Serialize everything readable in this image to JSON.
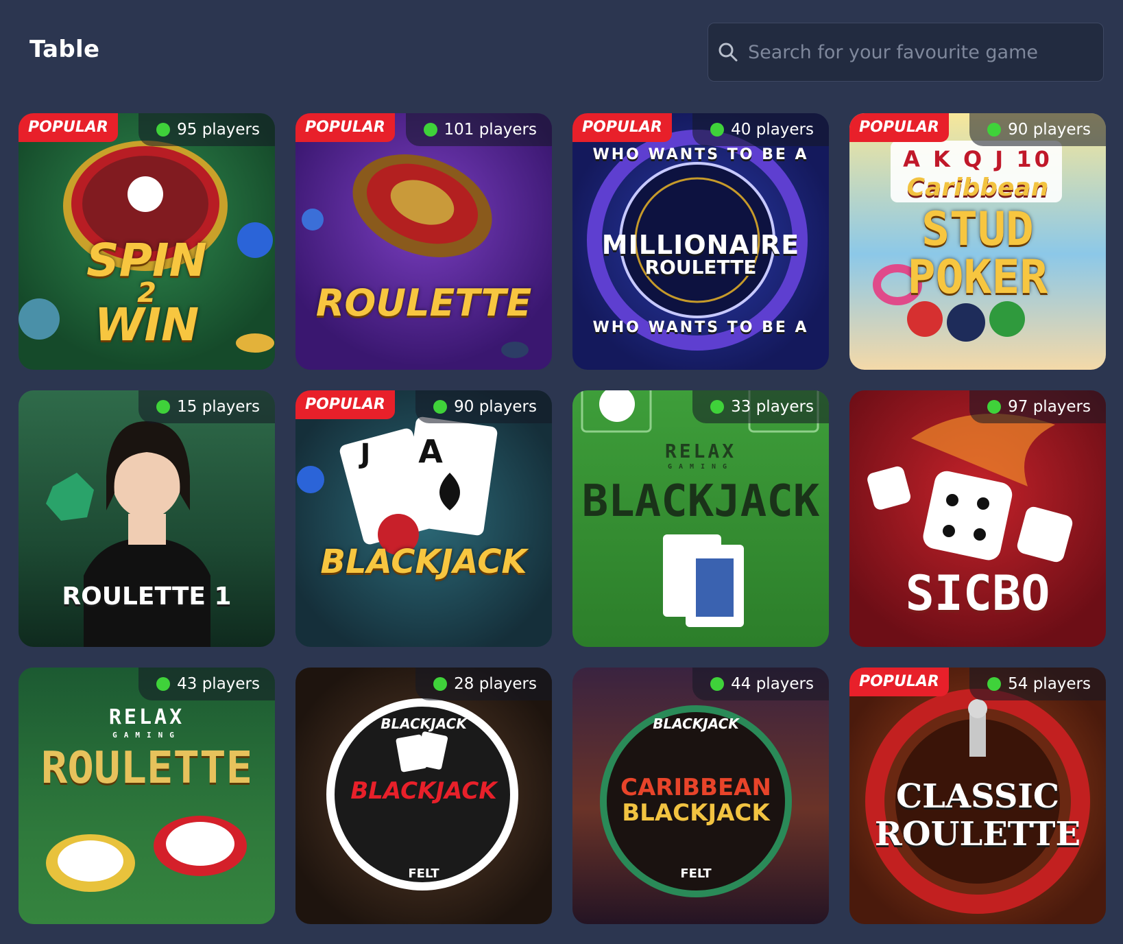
{
  "header": {
    "title": "Table",
    "search_placeholder": "Search for your favourite game"
  },
  "colors": {
    "background": "#2c3650",
    "popular_badge": "#e8202a",
    "online_dot": "#3fd23a"
  },
  "badge_label": "POPULAR",
  "games": [
    {
      "art_text": [
        "SPIN",
        "2",
        "WIN"
      ],
      "players": "95 players",
      "popular": true
    },
    {
      "art_text": [
        "ROULETTE"
      ],
      "players": "101 players",
      "popular": true
    },
    {
      "art_text": [
        "WHO WANTS TO BE A",
        "MILLIONAIRE",
        "ROULETTE",
        "WHO WANTS TO BE A"
      ],
      "players": "40 players",
      "popular": true
    },
    {
      "art_text": [
        "A K Q J 10",
        "Caribbean",
        "STUD",
        "POKER"
      ],
      "players": "90 players",
      "popular": true
    },
    {
      "art_text": [
        "ROULETTE 1"
      ],
      "players": "15 players",
      "popular": false
    },
    {
      "art_text": [
        "J",
        "A",
        "BLACKJACK"
      ],
      "players": "90 players",
      "popular": true
    },
    {
      "art_text": [
        "RELAX",
        "GAMING",
        "BLACKJACK"
      ],
      "players": "33 players",
      "popular": false
    },
    {
      "art_text": [
        "SICBO"
      ],
      "players": "97 players",
      "popular": false
    },
    {
      "art_text": [
        "RELAX",
        "GAMING",
        "ROULETTE"
      ],
      "players": "43 players",
      "popular": false
    },
    {
      "art_text": [
        "BLACKJACK",
        "BLACKJACK",
        "FELT"
      ],
      "players": "28 players",
      "popular": false
    },
    {
      "art_text": [
        "BLACKJACK",
        "CARIBBEAN",
        "BLACKJACK",
        "FELT"
      ],
      "players": "44 players",
      "popular": false
    },
    {
      "art_text": [
        "CLASSIC",
        "ROULETTE"
      ],
      "players": "54 players",
      "popular": true
    }
  ]
}
